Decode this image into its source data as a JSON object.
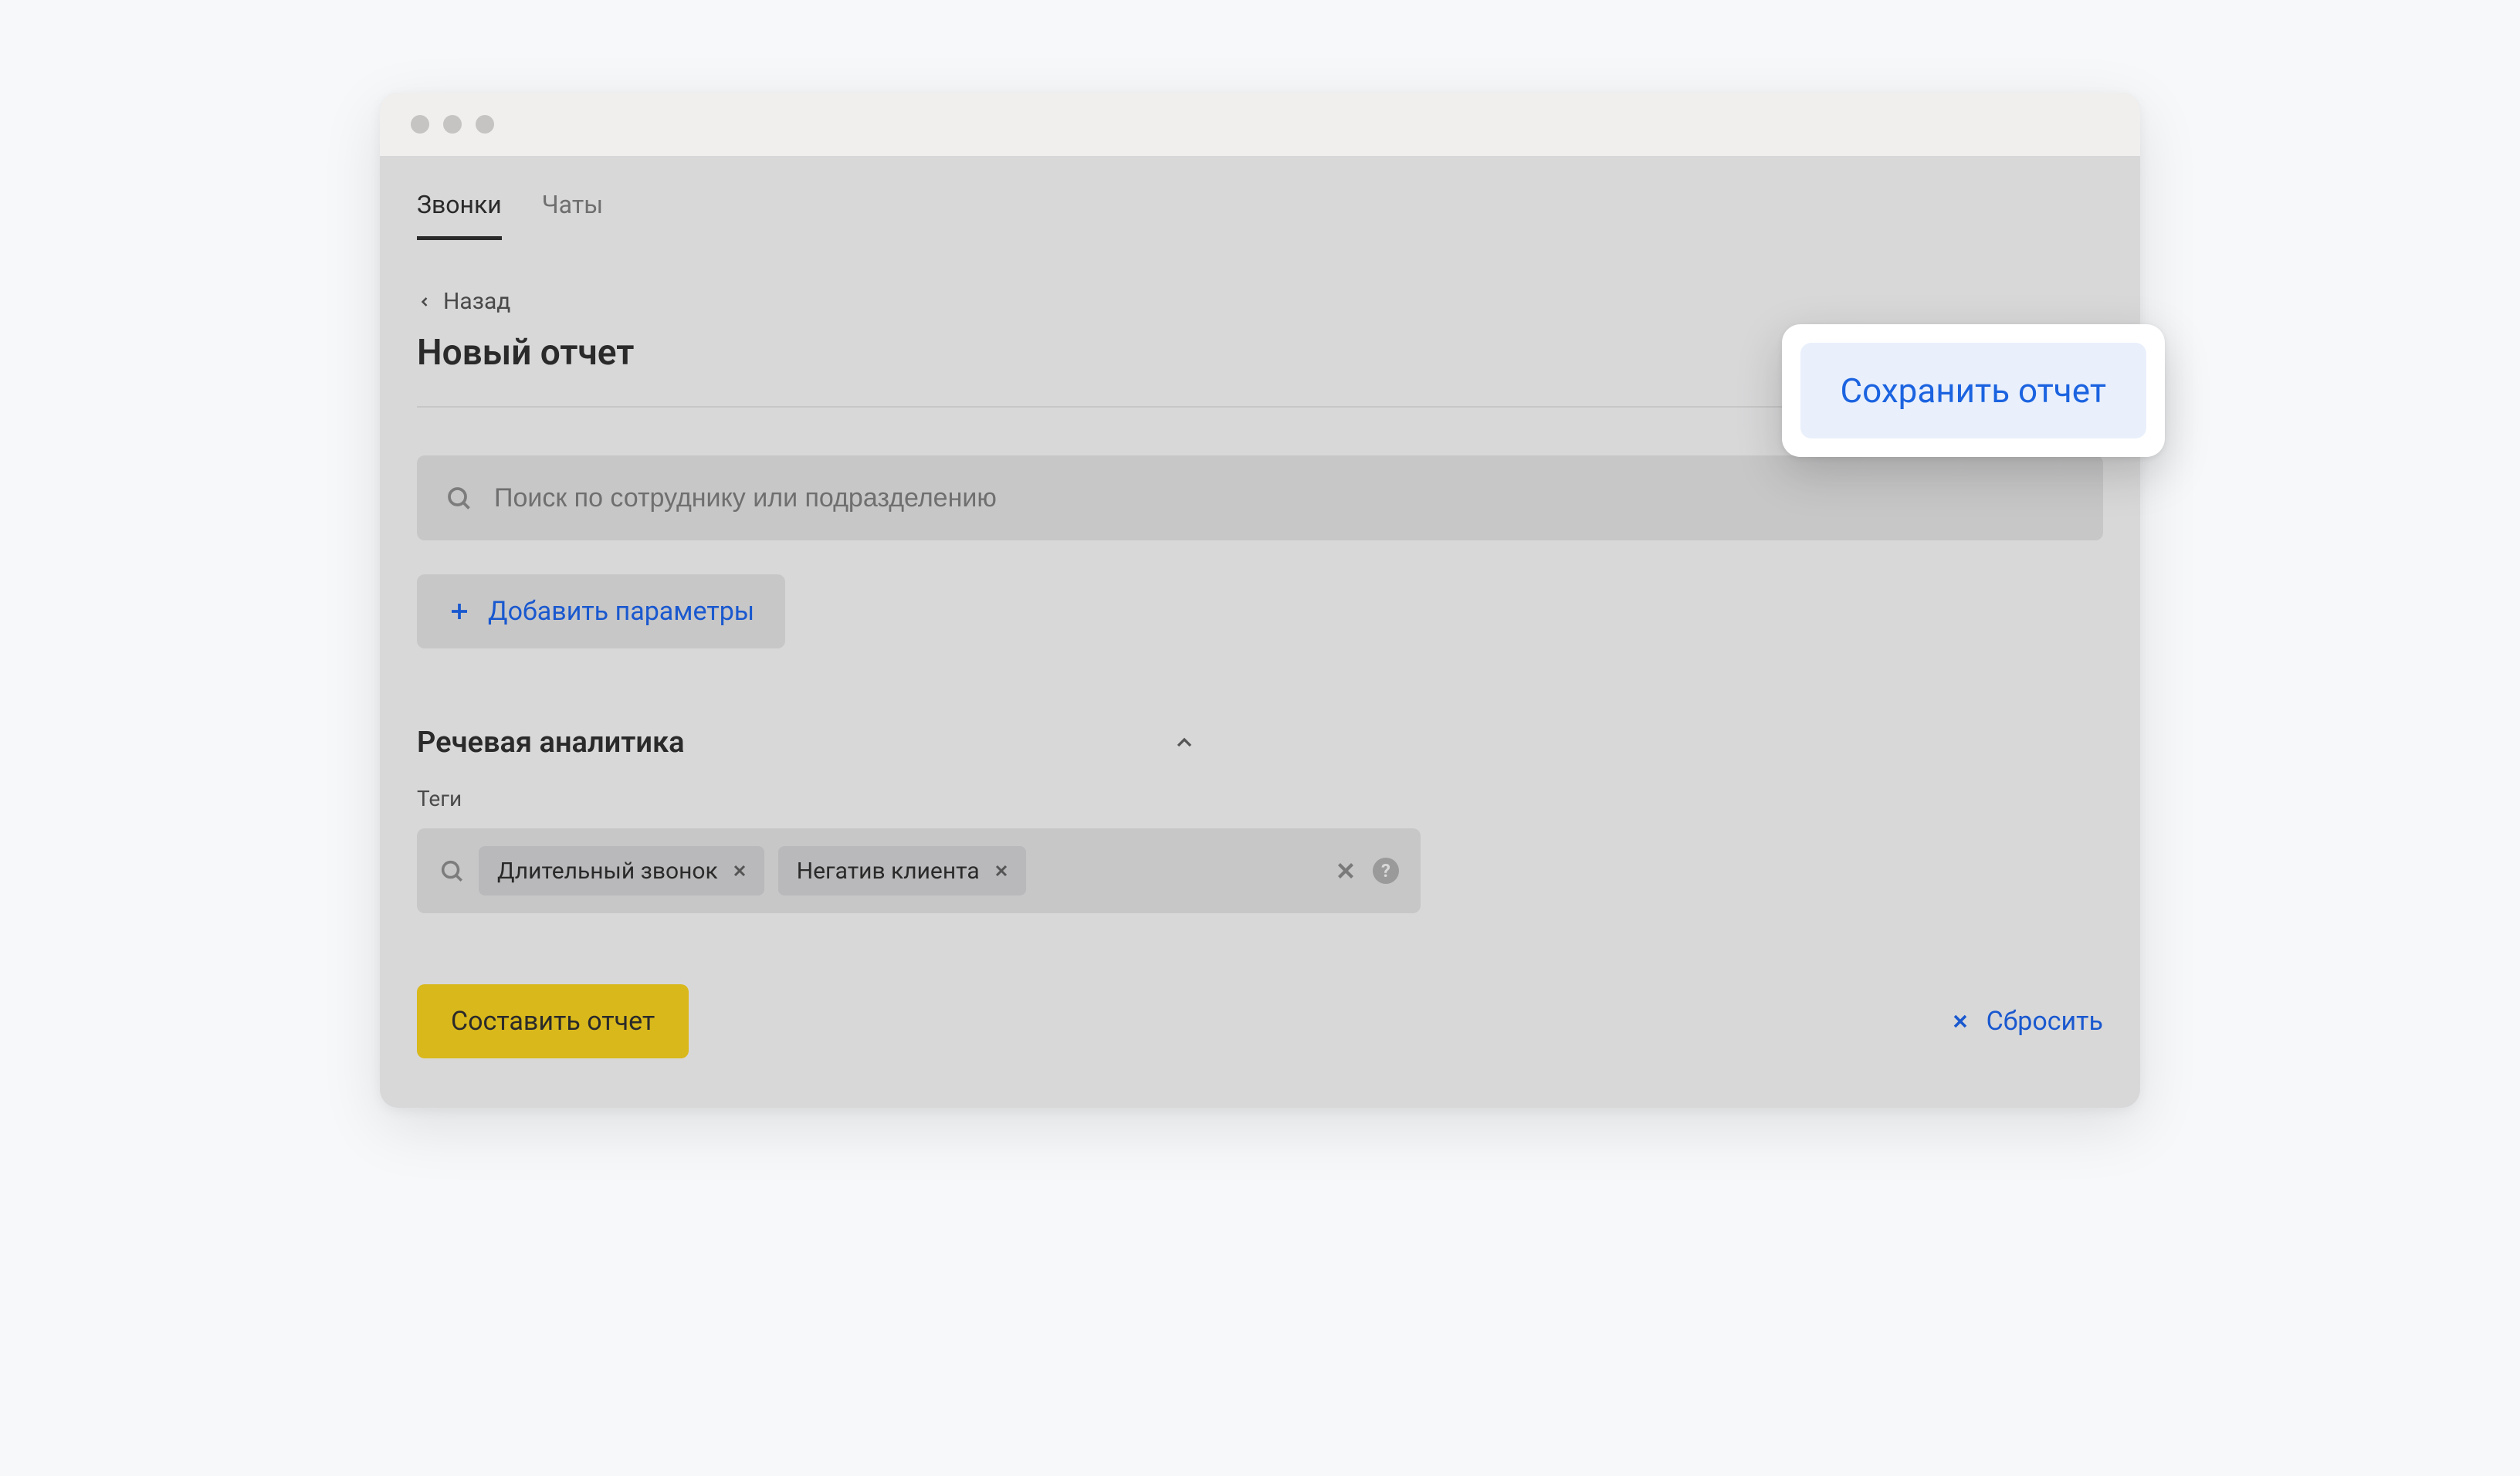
{
  "tabs": {
    "calls": "Звонки",
    "chats": "Чаты"
  },
  "back_label": "Назад",
  "page_title": "Новый отчет",
  "search": {
    "placeholder": "Поиск по сотруднику или подразделению"
  },
  "add_params_label": "Добавить параметры",
  "section": {
    "title": "Речевая аналитика",
    "tags_label": "Теги"
  },
  "tags": [
    {
      "label": "Длительный звонок"
    },
    {
      "label": "Негатив клиента"
    }
  ],
  "compose_label": "Составить отчет",
  "reset_label": "Сбросить",
  "save_report_label": "Сохранить отчет",
  "colors": {
    "accent_blue": "#1958cf",
    "accent_yellow": "#d9b81b"
  }
}
